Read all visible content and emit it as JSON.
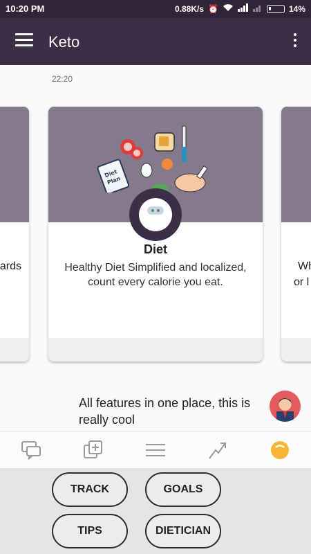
{
  "status": {
    "time": "10:20 PM",
    "speed": "0.88K/s",
    "battery": "14%"
  },
  "appbar": {
    "title": "Keto"
  },
  "feed": {
    "timestamp": "22:20",
    "left_card_partial_text": "ards",
    "right_card_partial_line1": "Wh",
    "right_card_partial_line2": "or l",
    "main_card": {
      "title": "Diet",
      "description": "Healthy Diet Simplified and localized, count every calorie you eat.",
      "illustration_label": "Diet Plan"
    },
    "chat_message": "All features in one place, this is really cool"
  },
  "bottom_nav": {
    "items": [
      "chat-icon",
      "add-icon",
      "list-icon",
      "trend-icon",
      "bot-icon"
    ],
    "active_color": "#f5b735"
  },
  "actions": {
    "track": "TRACK",
    "goals": "GOALS",
    "tips": "TIPS",
    "dietician": "DIETICIAN"
  },
  "colors": {
    "appbar": "#3b2e45",
    "card_header": "#847a8c"
  }
}
